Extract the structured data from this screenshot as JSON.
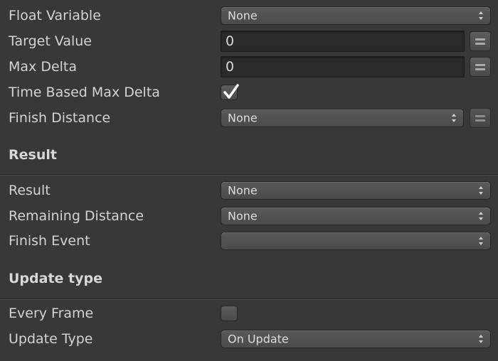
{
  "rows": {
    "float_variable": {
      "label": "Float Variable",
      "value": "None"
    },
    "target_value": {
      "label": "Target Value",
      "value": "0"
    },
    "max_delta": {
      "label": "Max Delta",
      "value": "0"
    },
    "time_based_max_delta": {
      "label": "Time Based Max Delta",
      "checked": true
    },
    "finish_distance": {
      "label": "Finish Distance",
      "value": "None"
    }
  },
  "sections": {
    "result_title": "Result",
    "update_title": "Update type"
  },
  "result_rows": {
    "result": {
      "label": "Result",
      "value": "None"
    },
    "remaining_distance": {
      "label": "Remaining Distance",
      "value": "None"
    },
    "finish_event": {
      "label": "Finish Event",
      "value": ""
    }
  },
  "update_rows": {
    "every_frame": {
      "label": "Every Frame",
      "checked": false
    },
    "update_type": {
      "label": "Update Type",
      "value": "On Update"
    }
  },
  "icons": {
    "dropdown_arrows": "updown-arrows-icon",
    "variable_toggle": "equals-icon",
    "checkmark": "checkmark-icon"
  }
}
